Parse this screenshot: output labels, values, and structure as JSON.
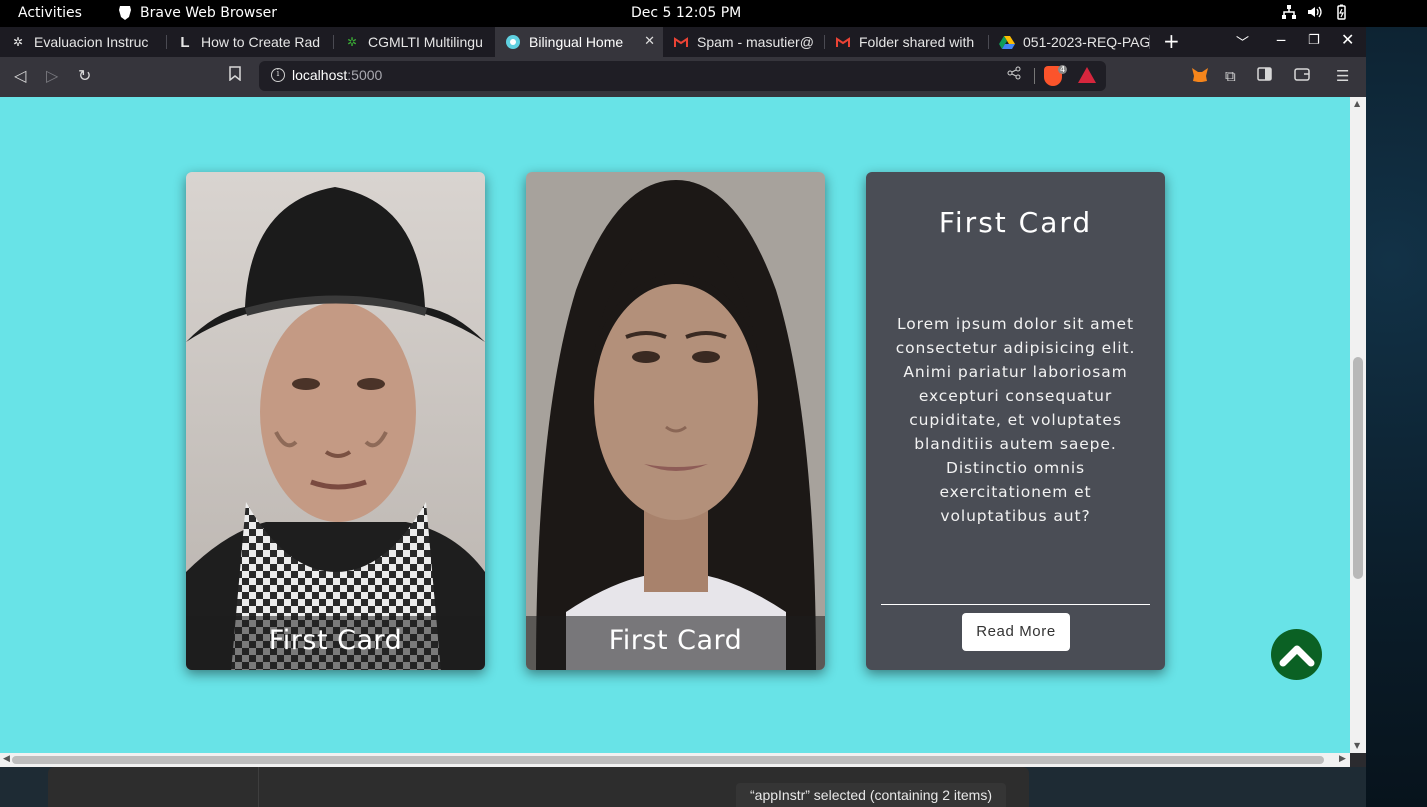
{
  "system": {
    "activities": "Activities",
    "app_name": "Brave Web Browser",
    "clock": "Dec 5  12:05 PM"
  },
  "tabs": [
    {
      "title": "Evaluacion Instruc",
      "icon": "sena-icon",
      "active": false
    },
    {
      "title": "How to Create Rad",
      "icon": "letter-l-icon",
      "active": false
    },
    {
      "title": "CGMLTI Multilingu",
      "icon": "sena-icon",
      "active": false
    },
    {
      "title": "Bilingual Home",
      "icon": "page-icon",
      "active": true
    },
    {
      "title": "Spam - masutier@",
      "icon": "gmail-icon",
      "active": false
    },
    {
      "title": "Folder shared with",
      "icon": "gmail-icon",
      "active": false
    },
    {
      "title": "051-2023-REQ-PAG",
      "icon": "google-drive-icon",
      "active": false
    }
  ],
  "address": {
    "host": "localhost",
    "port": ":5000"
  },
  "shields_count": "4",
  "page": {
    "cards": [
      {
        "caption": "First Card"
      },
      {
        "caption": "First Card"
      },
      {
        "title": "First Card",
        "body": "Lorem ipsum dolor sit amet consectetur adipisicing elit. Animi pariatur laboriosam excepturi consequatur cupiditate, et voluptates blanditiis autem saepe. Distinctio omnis exercitationem et voluptatibus aut?",
        "button": "Read More"
      }
    ]
  },
  "status_bar": {
    "text": "“appInstr” selected  (containing 2 items)"
  },
  "colors": {
    "page_background": "#68e3e7",
    "text_card": "#4a4d55",
    "scroll_top_button": "#0b6124"
  }
}
